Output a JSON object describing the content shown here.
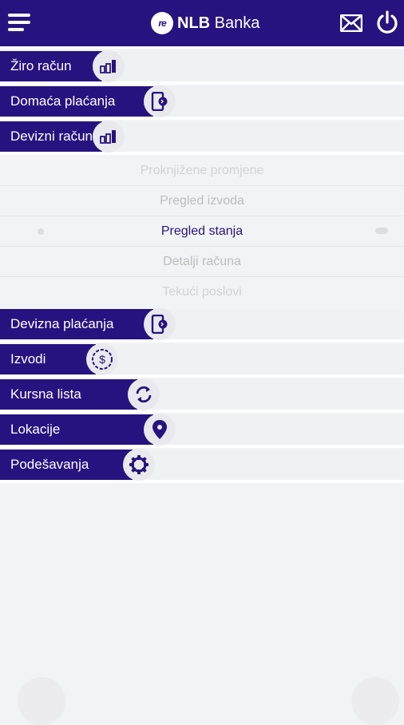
{
  "header": {
    "brand_mark": "re",
    "brand_bold": "NLB",
    "brand_rest": " Banka",
    "menu_icon": "hamburger-icon",
    "mail_icon": "mail-icon",
    "power_icon": "power-icon"
  },
  "menu": {
    "items": [
      {
        "label": "Žiro račun",
        "icon": "bar-chart-icon"
      },
      {
        "label": "Domaća plaćanja",
        "icon": "mobile-payment-icon"
      },
      {
        "label": "Devizni račun",
        "icon": "bar-chart-icon"
      },
      {
        "label": "Devizna plaćanja",
        "icon": "mobile-payment-icon"
      },
      {
        "label": "Izvodi",
        "icon": "dollar-coin-icon"
      },
      {
        "label": "Kursna lista",
        "icon": "refresh-icon"
      },
      {
        "label": "Lokacije",
        "icon": "location-pin-icon"
      },
      {
        "label": "Podešavanja",
        "icon": "gear-icon"
      }
    ]
  },
  "submenu": {
    "items": [
      {
        "label": "Proknjižene promjene"
      },
      {
        "label": "Pregled izvoda"
      },
      {
        "label": "Pregled stanja"
      },
      {
        "label": "Detalji računa"
      },
      {
        "label": "Tekući poslovi"
      }
    ],
    "active_index": 2
  },
  "colors": {
    "brand": "#27137f",
    "background": "#f2f3f4",
    "badge": "#e9e9ed"
  }
}
